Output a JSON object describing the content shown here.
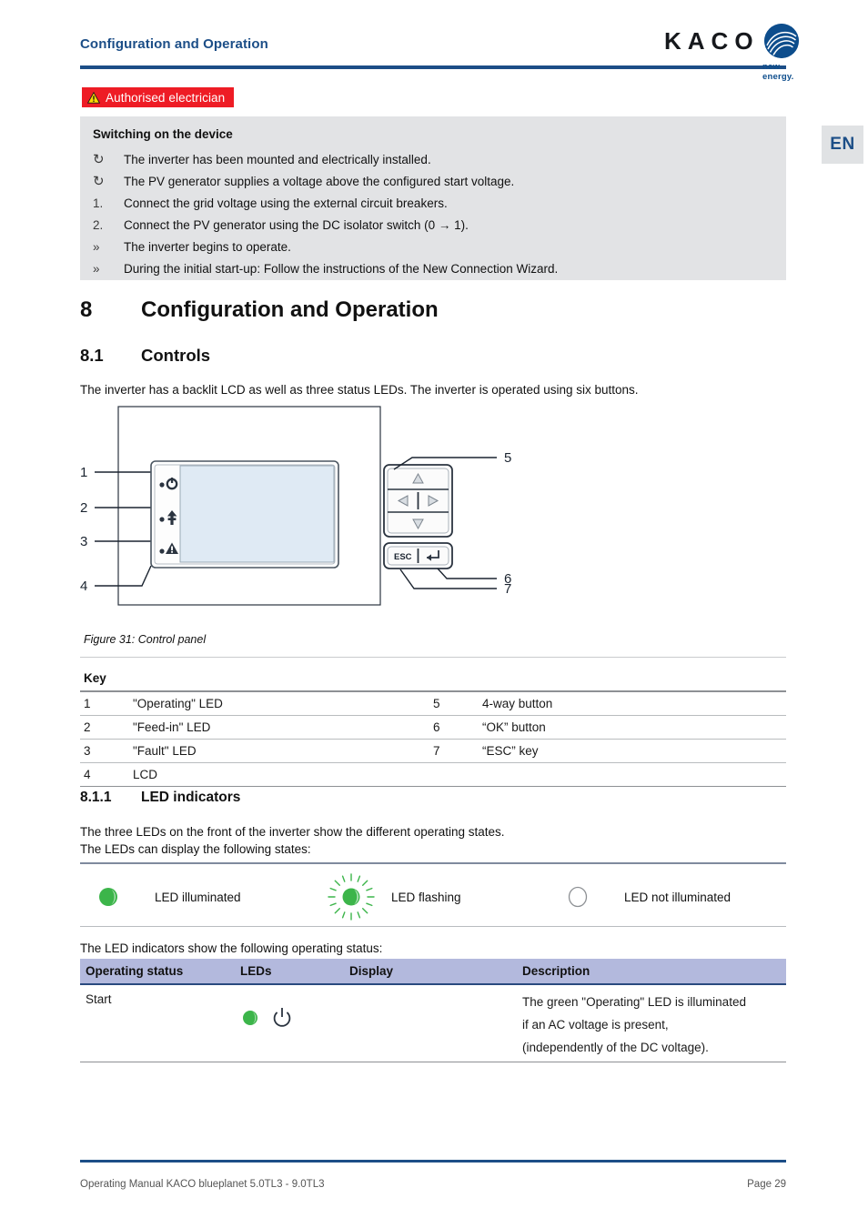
{
  "header": {
    "title": "Configuration and Operation",
    "logo_word": "KACO",
    "logo_tagline": "new energy.",
    "language_tab": "EN"
  },
  "warning_banner": {
    "icon": "warning-triangle-icon",
    "label": "Authorised electrician",
    "bg_color": "#ee1c25",
    "text_color": "#ffffff"
  },
  "instruction_box": {
    "title": "Switching on the device",
    "items": [
      {
        "marker": "↻",
        "marker_type": "precondition",
        "text": "The inverter has been mounted and electrically installed."
      },
      {
        "marker": "↻",
        "marker_type": "precondition",
        "text": "The PV generator supplies a voltage above the configured start voltage."
      },
      {
        "marker": "1.",
        "marker_type": "step",
        "text": "Connect the grid voltage using the external circuit breakers."
      },
      {
        "marker": "2.",
        "marker_type": "step",
        "text": "Connect the PV generator using the DC isolator switch (0 → 1)."
      },
      {
        "marker": "»",
        "marker_type": "result",
        "text": "The inverter begins to operate."
      },
      {
        "marker": "»",
        "marker_type": "result",
        "text": "During the initial start-up: Follow the instructions of the New Connection Wizard."
      }
    ]
  },
  "sections": {
    "h1_number": "8",
    "h1_title": "Configuration and Operation",
    "h2_number": "8.1",
    "h2_title": "Controls",
    "h2_intro": "The inverter has a backlit LCD as well as three status LEDs. The inverter is operated using six buttons.",
    "h3_number": "8.1.1",
    "h3_title": "LED indicators",
    "h3_intro_line1": "The three LEDs on the front of the inverter show the different operating states.",
    "h3_intro_line2": "The LEDs can display the following states:",
    "status_intro": "The LED indicators show the following operating status:"
  },
  "figure": {
    "caption": "Figure 31:  Control panel",
    "callouts": [
      "1",
      "2",
      "3",
      "4",
      "5",
      "6",
      "7"
    ],
    "button_labels": {
      "esc": "ESC"
    },
    "led_icons": [
      "power-led-icon",
      "feed-in-led-icon",
      "fault-led-icon"
    ],
    "pad_icons": [
      "arrow-up-icon",
      "arrow-left-icon",
      "arrow-right-icon",
      "arrow-down-icon",
      "enter-icon"
    ]
  },
  "key_table": {
    "title": "Key",
    "rows": [
      {
        "n1": "1",
        "t1": "\"Operating\" LED",
        "n2": "5",
        "t2": "4-way button"
      },
      {
        "n1": "2",
        "t1": "\"Feed-in\" LED",
        "n2": "6",
        "t2": "“OK” button"
      },
      {
        "n1": "3",
        "t1": "\"Fault\" LED",
        "n2": "7",
        "t2": "“ESC” key"
      },
      {
        "n1": "4",
        "t1": "LCD",
        "n2": "",
        "t2": ""
      }
    ]
  },
  "led_legend": {
    "items": [
      {
        "icon": "led-illuminated-icon",
        "label": "LED illuminated"
      },
      {
        "icon": "led-flashing-icon",
        "label": "LED flashing"
      },
      {
        "icon": "led-not-illuminated-icon",
        "label": "LED not illuminated"
      }
    ],
    "green": "#3cb54a",
    "outline": "#8d9094"
  },
  "status_table": {
    "headers": [
      "Operating status",
      "LEDs",
      "Display",
      "Description"
    ],
    "header_bg": "#b3b9dd",
    "rows": [
      {
        "status": "Start",
        "leds": [
          "green-led-icon",
          "power-symbol-icon"
        ],
        "display": "",
        "description_lines": [
          "The green \"Operating\" LED is illuminated",
          "if an AC voltage is present,",
          "(independently of the DC voltage)."
        ]
      }
    ]
  },
  "footer": {
    "left": "Operating Manual KACO blueplanet 5.0TL3 - 9.0TL3",
    "right": "Page 29"
  }
}
